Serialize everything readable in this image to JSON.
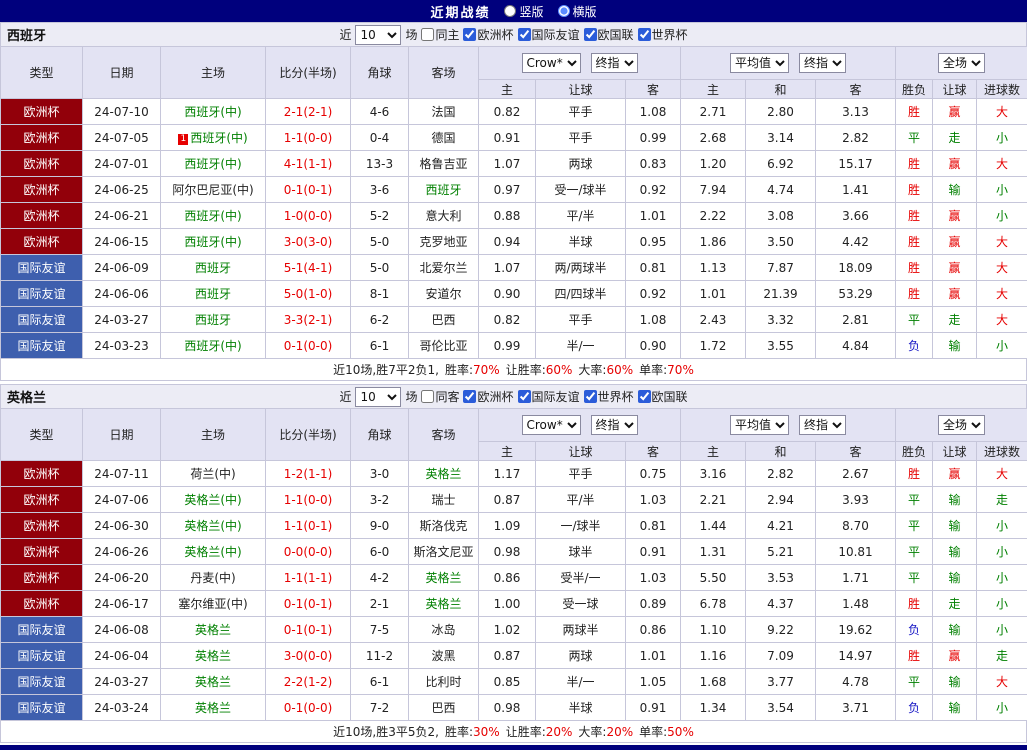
{
  "topbar": {
    "title": "近期战绩",
    "layout_options": [
      {
        "label": "竖版",
        "selected": false
      },
      {
        "label": "横版",
        "selected": true
      }
    ]
  },
  "table_header": {
    "type": "类型",
    "date": "日期",
    "home": "主场",
    "score": "比分(半场)",
    "corners": "角球",
    "away": "客场",
    "odds_source": "Crow*",
    "final_index": "终指",
    "average": "平均值",
    "full_match": "全场",
    "sub": {
      "home": "主",
      "handicap": "让球",
      "away": "客",
      "avg_home": "主",
      "avg_draw": "和",
      "avg_away": "客",
      "result": "胜负",
      "handicap_result": "让球",
      "goals": "进球数"
    }
  },
  "colors": {
    "navy": "#00007d",
    "euro_bg": "#92000a",
    "friendly_bg": "#3e5fae",
    "win_red": "#e60000",
    "draw_green": "#008000",
    "lose_blue": "#1515c4"
  },
  "sections": [
    {
      "team": "西班牙",
      "filter": {
        "near": "近",
        "count": "10",
        "games": "场",
        "same": "同主",
        "leagues": [
          "欧洲杯",
          "国际友谊",
          "欧国联",
          "世界杯"
        ]
      },
      "rows": [
        {
          "type": "欧洲杯",
          "date": "24-07-10",
          "home": "西班牙(中)",
          "score": "2-1(2-1)",
          "corners": "4-6",
          "away": "法国",
          "odds_home": "0.82",
          "handicap": "平手",
          "odds_away": "1.08",
          "avg_home": "2.71",
          "avg_draw": "2.80",
          "avg_away": "3.13",
          "result": "胜",
          "handicap_result": "赢",
          "goals_result": "大"
        },
        {
          "type": "欧洲杯",
          "date": "24-07-05",
          "home": "西班牙(中)",
          "badge": "1",
          "score": "1-1(0-0)",
          "corners": "0-4",
          "away": "德国",
          "odds_home": "0.91",
          "handicap": "平手",
          "odds_away": "0.99",
          "avg_home": "2.68",
          "avg_draw": "3.14",
          "avg_away": "2.82",
          "result": "平",
          "handicap_result": "走",
          "goals_result": "小"
        },
        {
          "type": "欧洲杯",
          "date": "24-07-01",
          "home": "西班牙(中)",
          "score": "4-1(1-1)",
          "corners": "13-3",
          "away": "格鲁吉亚",
          "odds_home": "1.07",
          "handicap": "两球",
          "odds_away": "0.83",
          "avg_home": "1.20",
          "avg_draw": "6.92",
          "avg_away": "15.17",
          "result": "胜",
          "handicap_result": "赢",
          "goals_result": "大"
        },
        {
          "type": "欧洲杯",
          "date": "24-06-25",
          "home": "阿尔巴尼亚(中)",
          "score": "0-1(0-1)",
          "corners": "3-6",
          "away": "西班牙",
          "odds_home": "0.97",
          "handicap": "受一/球半",
          "odds_away": "0.92",
          "avg_home": "7.94",
          "avg_draw": "4.74",
          "avg_away": "1.41",
          "result": "胜",
          "handicap_result": "输",
          "goals_result": "小"
        },
        {
          "type": "欧洲杯",
          "date": "24-06-21",
          "home": "西班牙(中)",
          "score": "1-0(0-0)",
          "corners": "5-2",
          "away": "意大利",
          "odds_home": "0.88",
          "handicap": "平/半",
          "odds_away": "1.01",
          "avg_home": "2.22",
          "avg_draw": "3.08",
          "avg_away": "3.66",
          "result": "胜",
          "handicap_result": "赢",
          "goals_result": "小"
        },
        {
          "type": "欧洲杯",
          "date": "24-06-15",
          "home": "西班牙(中)",
          "score": "3-0(3-0)",
          "corners": "5-0",
          "away": "克罗地亚",
          "odds_home": "0.94",
          "handicap": "半球",
          "odds_away": "0.95",
          "avg_home": "1.86",
          "avg_draw": "3.50",
          "avg_away": "4.42",
          "result": "胜",
          "handicap_result": "赢",
          "goals_result": "大"
        },
        {
          "type": "国际友谊",
          "date": "24-06-09",
          "home": "西班牙",
          "score": "5-1(4-1)",
          "corners": "5-0",
          "away": "北爱尔兰",
          "odds_home": "1.07",
          "handicap": "两/两球半",
          "odds_away": "0.81",
          "avg_home": "1.13",
          "avg_draw": "7.87",
          "avg_away": "18.09",
          "result": "胜",
          "handicap_result": "赢",
          "goals_result": "大"
        },
        {
          "type": "国际友谊",
          "date": "24-06-06",
          "home": "西班牙",
          "score": "5-0(1-0)",
          "corners": "8-1",
          "away": "安道尔",
          "odds_home": "0.90",
          "handicap": "四/四球半",
          "odds_away": "0.92",
          "avg_home": "1.01",
          "avg_draw": "21.39",
          "avg_away": "53.29",
          "result": "胜",
          "handicap_result": "赢",
          "goals_result": "大"
        },
        {
          "type": "国际友谊",
          "date": "24-03-27",
          "home": "西班牙",
          "score": "3-3(2-1)",
          "corners": "6-2",
          "away": "巴西",
          "odds_home": "0.82",
          "handicap": "平手",
          "odds_away": "1.08",
          "avg_home": "2.43",
          "avg_draw": "3.32",
          "avg_away": "2.81",
          "result": "平",
          "handicap_result": "走",
          "goals_result": "大"
        },
        {
          "type": "国际友谊",
          "date": "24-03-23",
          "home": "西班牙(中)",
          "score": "0-1(0-0)",
          "corners": "6-1",
          "away": "哥伦比亚",
          "odds_home": "0.99",
          "handicap": "半/一",
          "odds_away": "0.90",
          "avg_home": "1.72",
          "avg_draw": "3.55",
          "avg_away": "4.84",
          "result": "负",
          "handicap_result": "输",
          "goals_result": "小"
        }
      ],
      "summary": {
        "prefix": "近10场,胜7平2负1, ",
        "stats": [
          {
            "label": "胜率:",
            "value": "70%"
          },
          {
            "label": "让胜率:",
            "value": "60%"
          },
          {
            "label": "大率:",
            "value": "60%"
          },
          {
            "label": "单率:",
            "value": "70%"
          }
        ]
      }
    },
    {
      "team": "英格兰",
      "filter": {
        "near": "近",
        "count": "10",
        "games": "场",
        "same": "同客",
        "leagues": [
          "欧洲杯",
          "国际友谊",
          "世界杯",
          "欧国联"
        ]
      },
      "rows": [
        {
          "type": "欧洲杯",
          "date": "24-07-11",
          "home": "荷兰(中)",
          "score": "1-2(1-1)",
          "corners": "3-0",
          "away": "英格兰",
          "odds_home": "1.17",
          "handicap": "平手",
          "odds_away": "0.75",
          "avg_home": "3.16",
          "avg_draw": "2.82",
          "avg_away": "2.67",
          "result": "胜",
          "handicap_result": "赢",
          "goals_result": "大"
        },
        {
          "type": "欧洲杯",
          "date": "24-07-06",
          "home": "英格兰(中)",
          "score": "1-1(0-0)",
          "corners": "3-2",
          "away": "瑞士",
          "odds_home": "0.87",
          "handicap": "平/半",
          "odds_away": "1.03",
          "avg_home": "2.21",
          "avg_draw": "2.94",
          "avg_away": "3.93",
          "result": "平",
          "handicap_result": "输",
          "goals_result": "走"
        },
        {
          "type": "欧洲杯",
          "date": "24-06-30",
          "home": "英格兰(中)",
          "score": "1-1(0-1)",
          "corners": "9-0",
          "away": "斯洛伐克",
          "odds_home": "1.09",
          "handicap": "一/球半",
          "odds_away": "0.81",
          "avg_home": "1.44",
          "avg_draw": "4.21",
          "avg_away": "8.70",
          "result": "平",
          "handicap_result": "输",
          "goals_result": "小"
        },
        {
          "type": "欧洲杯",
          "date": "24-06-26",
          "home": "英格兰(中)",
          "score": "0-0(0-0)",
          "corners": "6-0",
          "away": "斯洛文尼亚",
          "odds_home": "0.98",
          "handicap": "球半",
          "odds_away": "0.91",
          "avg_home": "1.31",
          "avg_draw": "5.21",
          "avg_away": "10.81",
          "result": "平",
          "handicap_result": "输",
          "goals_result": "小"
        },
        {
          "type": "欧洲杯",
          "date": "24-06-20",
          "home": "丹麦(中)",
          "score": "1-1(1-1)",
          "corners": "4-2",
          "away": "英格兰",
          "odds_home": "0.86",
          "handicap": "受半/一",
          "odds_away": "1.03",
          "avg_home": "5.50",
          "avg_draw": "3.53",
          "avg_away": "1.71",
          "result": "平",
          "handicap_result": "输",
          "goals_result": "小"
        },
        {
          "type": "欧洲杯",
          "date": "24-06-17",
          "home": "塞尔维亚(中)",
          "score": "0-1(0-1)",
          "corners": "2-1",
          "away": "英格兰",
          "odds_home": "1.00",
          "handicap": "受一球",
          "odds_away": "0.89",
          "avg_home": "6.78",
          "avg_draw": "4.37",
          "avg_away": "1.48",
          "result": "胜",
          "handicap_result": "走",
          "goals_result": "小"
        },
        {
          "type": "国际友谊",
          "date": "24-06-08",
          "home": "英格兰",
          "score": "0-1(0-1)",
          "corners": "7-5",
          "away": "冰岛",
          "odds_home": "1.02",
          "handicap": "两球半",
          "odds_away": "0.86",
          "avg_home": "1.10",
          "avg_draw": "9.22",
          "avg_away": "19.62",
          "result": "负",
          "handicap_result": "输",
          "goals_result": "小"
        },
        {
          "type": "国际友谊",
          "date": "24-06-04",
          "home": "英格兰",
          "score": "3-0(0-0)",
          "corners": "11-2",
          "away": "波黑",
          "odds_home": "0.87",
          "handicap": "两球",
          "odds_away": "1.01",
          "avg_home": "1.16",
          "avg_draw": "7.09",
          "avg_away": "14.97",
          "result": "胜",
          "handicap_result": "赢",
          "goals_result": "走"
        },
        {
          "type": "国际友谊",
          "date": "24-03-27",
          "home": "英格兰",
          "score": "2-2(1-2)",
          "corners": "6-1",
          "away": "比利时",
          "odds_home": "0.85",
          "handicap": "半/一",
          "odds_away": "1.05",
          "avg_home": "1.68",
          "avg_draw": "3.77",
          "avg_away": "4.78",
          "result": "平",
          "handicap_result": "输",
          "goals_result": "大"
        },
        {
          "type": "国际友谊",
          "date": "24-03-24",
          "home": "英格兰",
          "score": "0-1(0-0)",
          "corners": "7-2",
          "away": "巴西",
          "odds_home": "0.98",
          "handicap": "半球",
          "odds_away": "0.91",
          "avg_home": "1.34",
          "avg_draw": "3.54",
          "avg_away": "3.71",
          "result": "负",
          "handicap_result": "输",
          "goals_result": "小"
        }
      ],
      "summary": {
        "prefix": "近10场,胜3平5负2, ",
        "stats": [
          {
            "label": "胜率:",
            "value": "30%"
          },
          {
            "label": "让胜率:",
            "value": "20%"
          },
          {
            "label": "大率:",
            "value": "20%"
          },
          {
            "label": "单率:",
            "value": "50%"
          }
        ]
      }
    }
  ]
}
